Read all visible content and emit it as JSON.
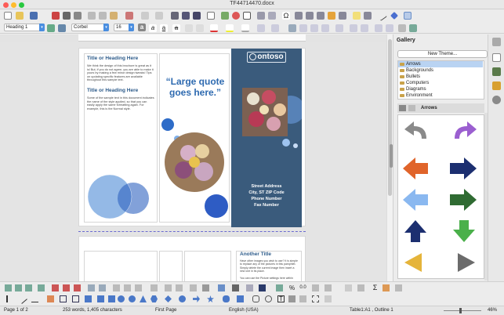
{
  "window": {
    "title": "TF44714470.docx"
  },
  "formatting": {
    "paragraph_style": "Heading 1",
    "font_name": "Corbel",
    "font_size": "16"
  },
  "document": {
    "left_col": {
      "heading1": "Title or Heading Here",
      "body1": "We think the design of this brochure is great as it is! But, if you do not agree, you are able to make it yours by making a few minor design tweaks! Tips on updating specific features are available throughout this sample text.",
      "heading2": "Title or Heading Here",
      "body2": "Some of the sample text in this document indicates the name of the style applied, so that you can easily apply the same formatting again. For example, this is the Normal style."
    },
    "middle_col": {
      "quote": "“Large quote goes here.”"
    },
    "right_col": {
      "logo": "ontoso",
      "address_lines": [
        "Street Address",
        "City, ST  ZIP Code",
        "Phone Number",
        "Fax Number"
      ]
    },
    "page2": {
      "heading": "Another Title",
      "body": "Have other images you wish to use? It is simple to replace any of the pictures in this pamphlet. Simply delete the current image then insert a new one in its place.",
      "body2": "You can use the Picture settings here within"
    }
  },
  "gallery": {
    "title": "Gallery",
    "new_theme_button": "New Theme...",
    "themes": [
      "Arrows",
      "Backgrounds",
      "Bullets",
      "Computers",
      "Diagrams",
      "Environment"
    ],
    "selected_theme": "Arrows",
    "view_label": "Arrows"
  },
  "status": {
    "page": "Page 1 of 2",
    "words": "253 words, 1,405 characters",
    "page_style": "First Page",
    "language": "English (USA)",
    "table_cell": "Table1:A1 , Outline 1",
    "zoom": "46%"
  },
  "colors": {
    "accent": "#4a8ee0",
    "brochure_blue": "#3a5b7c",
    "heading_blue": "#2d5b8a",
    "circle_blue": "#2e63c0"
  }
}
